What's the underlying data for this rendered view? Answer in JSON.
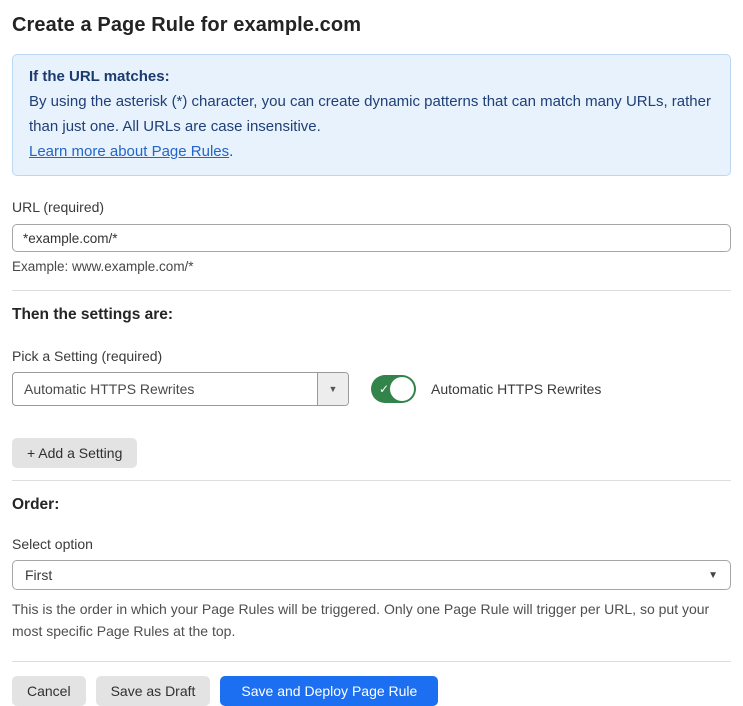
{
  "page": {
    "title": "Create a Page Rule for example.com"
  },
  "info_box": {
    "heading": "If the URL matches:",
    "body": "By using the asterisk (*) character, you can create dynamic patterns that can match many URLs, rather than just one. All URLs are case insensitive.",
    "link_label": "Learn more about Page Rules",
    "link_suffix": "."
  },
  "url_field": {
    "label": "URL (required)",
    "value": "*example.com/*",
    "example": "Example: www.example.com/*"
  },
  "settings_section": {
    "heading": "Then the settings are:",
    "pick_label": "Pick a Setting (required)",
    "selected_setting": "Automatic HTTPS Rewrites",
    "dropdown_caret": "▼",
    "toggle_state": "on",
    "toggle_check": "✓",
    "toggle_label": "Automatic HTTPS Rewrites",
    "add_button_label": "+ Add a Setting"
  },
  "order_section": {
    "heading": "Order:",
    "select_label": "Select option",
    "selected_option": "First",
    "dropdown_caret": "▼",
    "help_text": "This is the order in which your Page Rules will be triggered. Only one Page Rule will trigger per URL, so put your most specific Page Rules at the top."
  },
  "footer": {
    "cancel_label": "Cancel",
    "save_draft_label": "Save as Draft",
    "save_deploy_label": "Save and Deploy Page Rule"
  },
  "colors": {
    "info_bg": "#e8f2fc",
    "info_border": "#bcd8f4",
    "info_text": "#1e3f77",
    "link_blue": "#2365c8",
    "toggle_green": "#33844a",
    "primary_blue": "#1d6ff2",
    "button_gray": "#e3e3e3"
  }
}
